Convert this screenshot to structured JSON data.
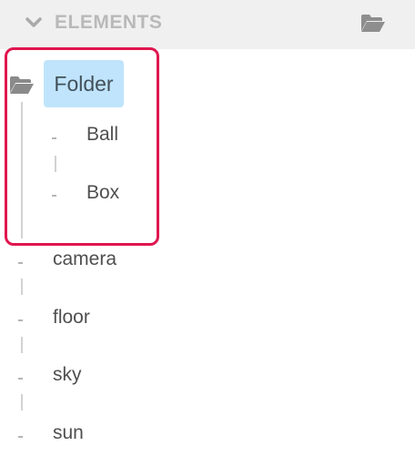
{
  "header": {
    "title": "ELEMENTS",
    "collapse_icon": "chevron-down-icon",
    "folder_icon": "folder-open-icon"
  },
  "tree": {
    "folder": {
      "label": "Folder",
      "icon": "folder-open-icon",
      "selected": true,
      "children": [
        "Ball",
        "Box"
      ]
    },
    "items": [
      "camera",
      "floor",
      "sky",
      "sun"
    ]
  },
  "colors": {
    "header_bg": "#f0f0f0",
    "header_text": "#b9b9b9",
    "selected_bg": "#bfe4fb",
    "highlight": "#e0164f",
    "tree_line": "#d2d2d2"
  }
}
